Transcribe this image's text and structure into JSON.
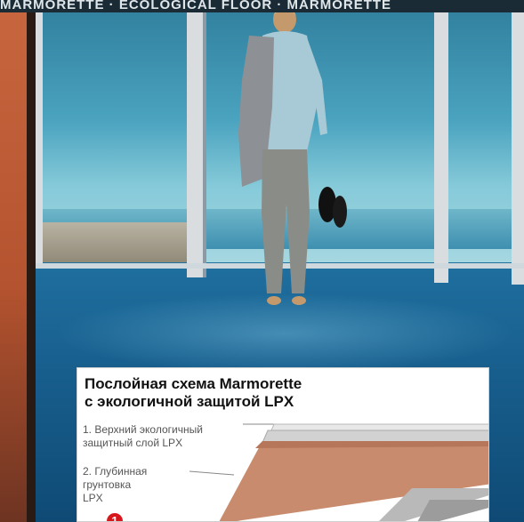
{
  "banner": {
    "text": "MARMORETTE · ECOLOGICAL FLOOR · MARMORETTE"
  },
  "card": {
    "title_line1": "Послойная схема Marmorette",
    "title_line2": "с экологичной защитой LPX",
    "legend": [
      {
        "line1": "1. Верхний экологичный",
        "line2": "защитный слой LPX"
      },
      {
        "line1": "2. Глубинная",
        "line2": "грунтовка",
        "line3": "LPX"
      }
    ],
    "badge": "1"
  },
  "colors": {
    "sky": "#4aa3bf",
    "floor": "#1f6f9f",
    "wall": "#c8663f",
    "accent_red": "#d8171c",
    "layer_terracotta": "#c98b6d"
  }
}
